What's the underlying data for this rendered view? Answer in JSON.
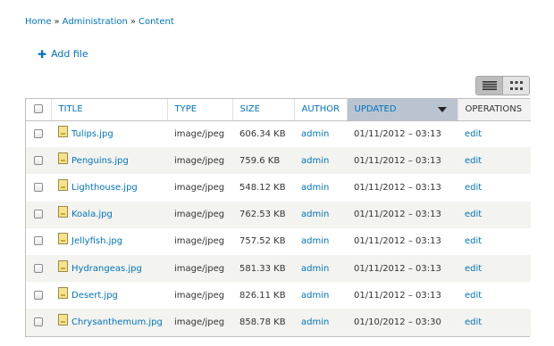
{
  "breadcrumb": {
    "items": [
      "Home",
      "Administration",
      "Content"
    ],
    "separator": "»"
  },
  "actions": {
    "add_file_label": "Add file",
    "add_file_icon": "plus-icon"
  },
  "view_toggle": {
    "active": "list-view-icon",
    "inactive": "grid-view-icon"
  },
  "table": {
    "headers": {
      "title": "TITLE",
      "type": "TYPE",
      "size": "SIZE",
      "author": "AUTHOR",
      "updated": "UPDATED",
      "operations": "OPERATIONS"
    },
    "sorted_column": "updated",
    "rows": [
      {
        "title": "Tulips.jpg",
        "type": "image/jpeg",
        "size": "606.34 KB",
        "author": "admin",
        "updated": "01/11/2012 – 03:13",
        "op": "edit"
      },
      {
        "title": "Penguins.jpg",
        "type": "image/jpeg",
        "size": "759.6 KB",
        "author": "admin",
        "updated": "01/11/2012 – 03:13",
        "op": "edit"
      },
      {
        "title": "Lighthouse.jpg",
        "type": "image/jpeg",
        "size": "548.12 KB",
        "author": "admin",
        "updated": "01/11/2012 – 03:13",
        "op": "edit"
      },
      {
        "title": "Koala.jpg",
        "type": "image/jpeg",
        "size": "762.53 KB",
        "author": "admin",
        "updated": "01/11/2012 – 03:13",
        "op": "edit"
      },
      {
        "title": "Jellyfish.jpg",
        "type": "image/jpeg",
        "size": "757.52 KB",
        "author": "admin",
        "updated": "01/11/2012 – 03:13",
        "op": "edit"
      },
      {
        "title": "Hydrangeas.jpg",
        "type": "image/jpeg",
        "size": "581.33 KB",
        "author": "admin",
        "updated": "01/11/2012 – 03:13",
        "op": "edit"
      },
      {
        "title": "Desert.jpg",
        "type": "image/jpeg",
        "size": "826.11 KB",
        "author": "admin",
        "updated": "01/11/2012 – 03:13",
        "op": "edit"
      },
      {
        "title": "Chrysanthemum.jpg",
        "type": "image/jpeg",
        "size": "858.78 KB",
        "author": "admin",
        "updated": "01/10/2012 – 03:30",
        "op": "edit"
      }
    ]
  },
  "colors": {
    "link": "#0074bd",
    "sorted_header_bg": "#b9c4d0",
    "row_alt_bg": "#f3f3ef"
  }
}
